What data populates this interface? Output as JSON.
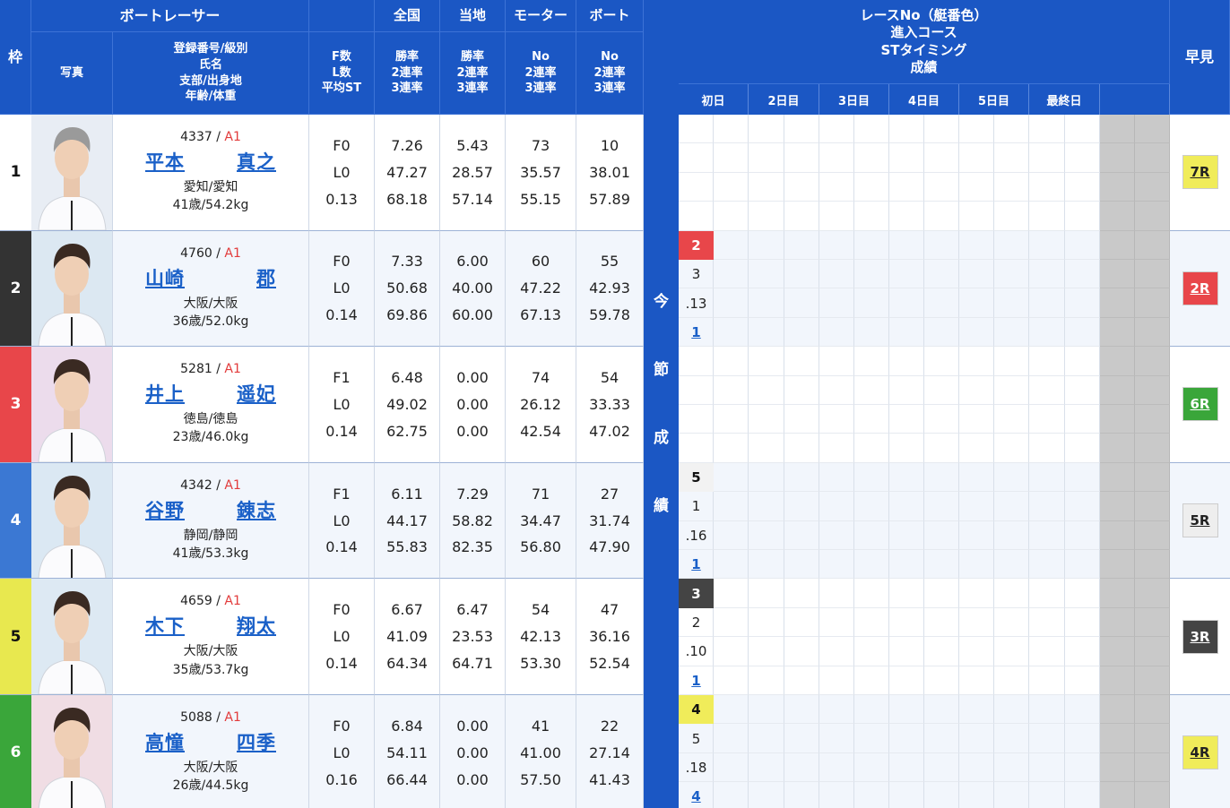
{
  "headers": {
    "waku": "枠",
    "photo": "写真",
    "boat_racer": "ボートレーサー",
    "racer_info": [
      "登録番号/級別",
      "氏名",
      "支部/出身地",
      "年齢/体重"
    ],
    "flst": [
      "F数",
      "L数",
      "平均ST"
    ],
    "national": "全国",
    "local": "当地",
    "motor": "モーター",
    "boat": "ボート",
    "rates": [
      "勝率",
      "2連率",
      "3連率"
    ],
    "no_rates": [
      "No",
      "2連率",
      "3連率"
    ],
    "race_info": [
      "レースNo（艇番色）",
      "進入コース",
      "STタイミング",
      "成績"
    ],
    "days": [
      "初日",
      "2日目",
      "3日目",
      "4日目",
      "5日目",
      "最終日"
    ],
    "hayami": "早見",
    "konsetsu": [
      "今",
      "節",
      "成",
      "績"
    ]
  },
  "colors": {
    "header_blue": "#1b57c4",
    "frame": [
      "#ffffff",
      "#333333",
      "#e8464a",
      "#3b78d3",
      "#e8e84f",
      "#3aa63a"
    ],
    "frame_text": [
      "#111111",
      "#ffffff",
      "#ffffff",
      "#ffffff",
      "#111111",
      "#ffffff"
    ]
  },
  "racers": [
    {
      "frame": "1",
      "reg": "4337",
      "cls": "A1",
      "name_last": "平本",
      "name_first": "真之",
      "branch": "愛知/愛知",
      "agewt": "41歳/54.2kg",
      "f": "F0",
      "l": "L0",
      "st": "0.13",
      "nat": [
        "7.26",
        "47.27",
        "68.18"
      ],
      "loc": [
        "5.43",
        "28.57",
        "57.14"
      ],
      "motor": [
        "73",
        "35.57",
        "55.15"
      ],
      "boat": [
        "10",
        "38.01",
        "57.89"
      ],
      "day1": [
        "",
        "",
        "",
        ""
      ],
      "hayami": "7R",
      "hayami_bg": "#f0ec5a",
      "hayami_fg": "#222222",
      "photo_bg": "#e8edf4"
    },
    {
      "frame": "2",
      "reg": "4760",
      "cls": "A1",
      "name_last": "山崎",
      "name_first": "郡",
      "branch": "大阪/大阪",
      "agewt": "36歳/52.0kg",
      "f": "F0",
      "l": "L0",
      "st": "0.14",
      "nat": [
        "7.33",
        "50.68",
        "69.86"
      ],
      "loc": [
        "6.00",
        "40.00",
        "60.00"
      ],
      "motor": [
        "60",
        "47.22",
        "67.13"
      ],
      "boat": [
        "55",
        "42.93",
        "59.78"
      ],
      "day1": [
        "2",
        "3",
        ".13",
        "1"
      ],
      "badge_bg": "#e8464a",
      "badge_fg": "#ffffff",
      "hayami": "2R",
      "hayami_bg": "#e8464a",
      "hayami_fg": "#ffffff",
      "photo_bg": "#dce8f2"
    },
    {
      "frame": "3",
      "reg": "5281",
      "cls": "A1",
      "name_last": "井上",
      "name_first": "遥妃",
      "branch": "徳島/徳島",
      "agewt": "23歳/46.0kg",
      "f": "F1",
      "l": "L0",
      "st": "0.14",
      "nat": [
        "6.48",
        "49.02",
        "62.75"
      ],
      "loc": [
        "0.00",
        "0.00",
        "0.00"
      ],
      "motor": [
        "74",
        "26.12",
        "42.54"
      ],
      "boat": [
        "54",
        "33.33",
        "47.02"
      ],
      "day1": [
        "",
        "",
        "",
        ""
      ],
      "hayami": "6R",
      "hayami_bg": "#3aa63a",
      "hayami_fg": "#ffffff",
      "photo_bg": "#ecdcec"
    },
    {
      "frame": "4",
      "reg": "4342",
      "cls": "A1",
      "name_last": "谷野",
      "name_first": "錬志",
      "branch": "静岡/静岡",
      "agewt": "41歳/53.3kg",
      "f": "F1",
      "l": "L0",
      "st": "0.14",
      "nat": [
        "6.11",
        "44.17",
        "55.83"
      ],
      "loc": [
        "7.29",
        "58.82",
        "82.35"
      ],
      "motor": [
        "71",
        "34.47",
        "56.80"
      ],
      "boat": [
        "27",
        "31.74",
        "47.90"
      ],
      "day1": [
        "5",
        "1",
        ".16",
        "1"
      ],
      "badge_bg": "#f2f2f2",
      "badge_fg": "#111111",
      "hayami": "5R",
      "hayami_bg": "#eeeeee",
      "hayami_fg": "#222222",
      "photo_bg": "#dbe8f3"
    },
    {
      "frame": "5",
      "reg": "4659",
      "cls": "A1",
      "name_last": "木下",
      "name_first": "翔太",
      "branch": "大阪/大阪",
      "agewt": "35歳/53.7kg",
      "f": "F0",
      "l": "L0",
      "st": "0.14",
      "nat": [
        "6.67",
        "41.09",
        "64.34"
      ],
      "loc": [
        "6.47",
        "23.53",
        "64.71"
      ],
      "motor": [
        "54",
        "42.13",
        "53.30"
      ],
      "boat": [
        "47",
        "36.16",
        "52.54"
      ],
      "day1": [
        "3",
        "2",
        ".10",
        "1"
      ],
      "badge_bg": "#444444",
      "badge_fg": "#ffffff",
      "hayami": "3R",
      "hayami_bg": "#444444",
      "hayami_fg": "#ffffff",
      "photo_bg": "#dde9f3"
    },
    {
      "frame": "6",
      "reg": "5088",
      "cls": "A1",
      "name_last": "高憧",
      "name_first": "四季",
      "branch": "大阪/大阪",
      "agewt": "26歳/44.5kg",
      "f": "F0",
      "l": "L0",
      "st": "0.16",
      "nat": [
        "6.84",
        "54.11",
        "66.44"
      ],
      "loc": [
        "0.00",
        "0.00",
        "0.00"
      ],
      "motor": [
        "41",
        "41.00",
        "57.50"
      ],
      "boat": [
        "22",
        "27.14",
        "41.43"
      ],
      "day1": [
        "4",
        "5",
        ".18",
        "4"
      ],
      "badge_bg": "#f0ec5a",
      "badge_fg": "#111111",
      "hayami": "4R",
      "hayami_bg": "#f0ec5a",
      "hayami_fg": "#222222",
      "photo_bg": "#f0dde4"
    }
  ]
}
